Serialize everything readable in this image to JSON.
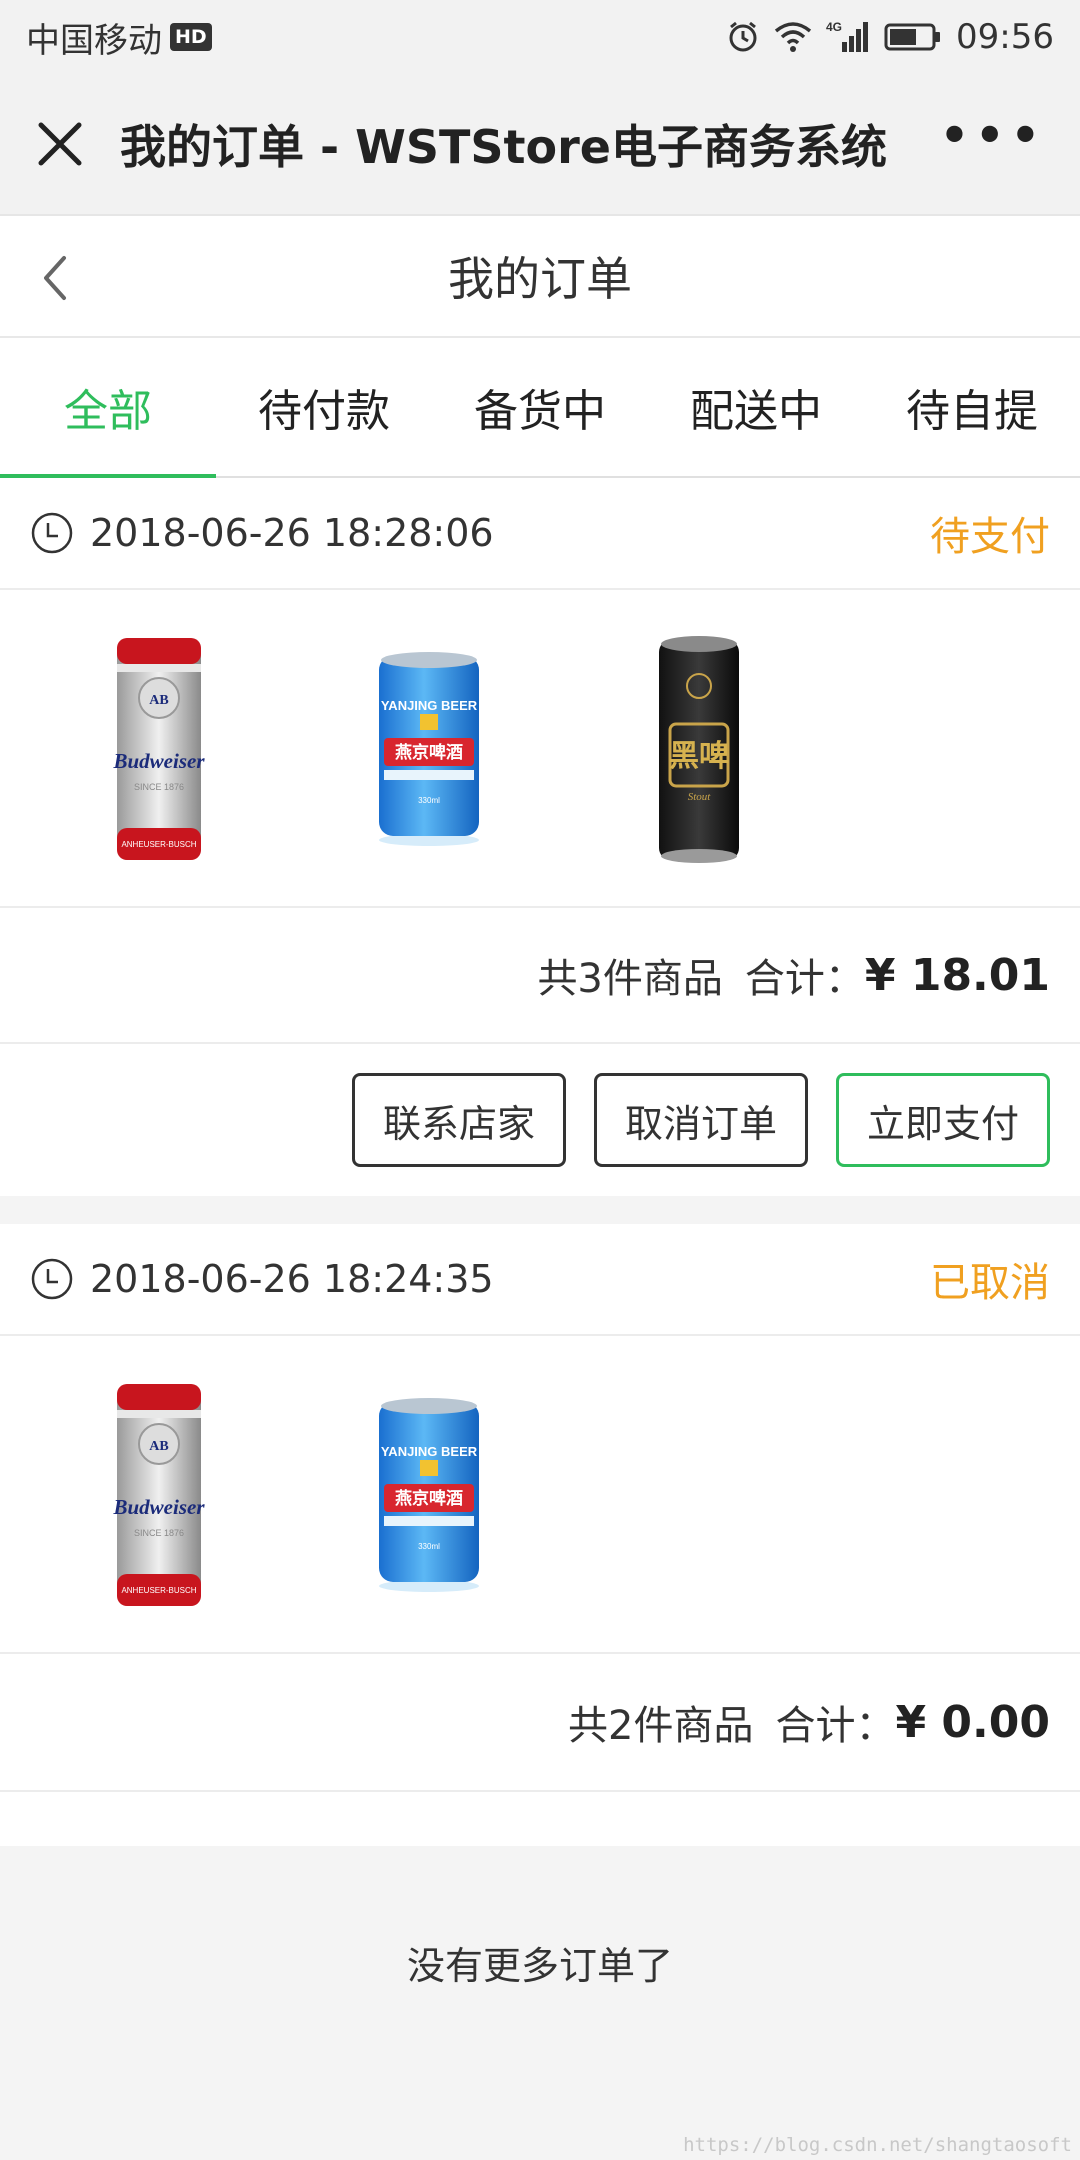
{
  "status_bar": {
    "carrier": "中国移动",
    "hd": "HD",
    "network": "4G",
    "time": "09:56"
  },
  "wechat_bar": {
    "title": "我的订单 - WSTStore电子商务系统",
    "more": "•••"
  },
  "header": {
    "title": "我的订单"
  },
  "tabs": [
    {
      "label": "全部",
      "active": true
    },
    {
      "label": "待付款",
      "active": false
    },
    {
      "label": "备货中",
      "active": false
    },
    {
      "label": "配送中",
      "active": false
    },
    {
      "label": "待自提",
      "active": false
    }
  ],
  "orders": [
    {
      "time": "2018-06-26 18:28:06",
      "status": "待支付",
      "goods": [
        {
          "name": "Budweiser",
          "icon": "budweiser-can"
        },
        {
          "name": "燕京啤酒",
          "icon": "yanjing-beer-can"
        },
        {
          "name": "黑啤",
          "icon": "black-beer-can"
        }
      ],
      "count_text": "共3件商品",
      "total_label": "合计：",
      "total_price": "¥ 18.01",
      "buttons": {
        "contact": "联系店家",
        "cancel": "取消订单",
        "pay": "立即支付"
      }
    },
    {
      "time": "2018-06-26 18:24:35",
      "status": "已取消",
      "goods": [
        {
          "name": "Budweiser",
          "icon": "budweiser-can"
        },
        {
          "name": "燕京啤酒",
          "icon": "yanjing-beer-can"
        }
      ],
      "count_text": "共2件商品",
      "total_label": "合计：",
      "total_price": "¥ 0.00"
    }
  ],
  "footer": {
    "no_more": "没有更多订单了"
  },
  "watermark": "https://blog.csdn.net/shangtaosoft",
  "colors": {
    "accent_green": "#2fbd5c",
    "status_orange": "#f0a020"
  }
}
